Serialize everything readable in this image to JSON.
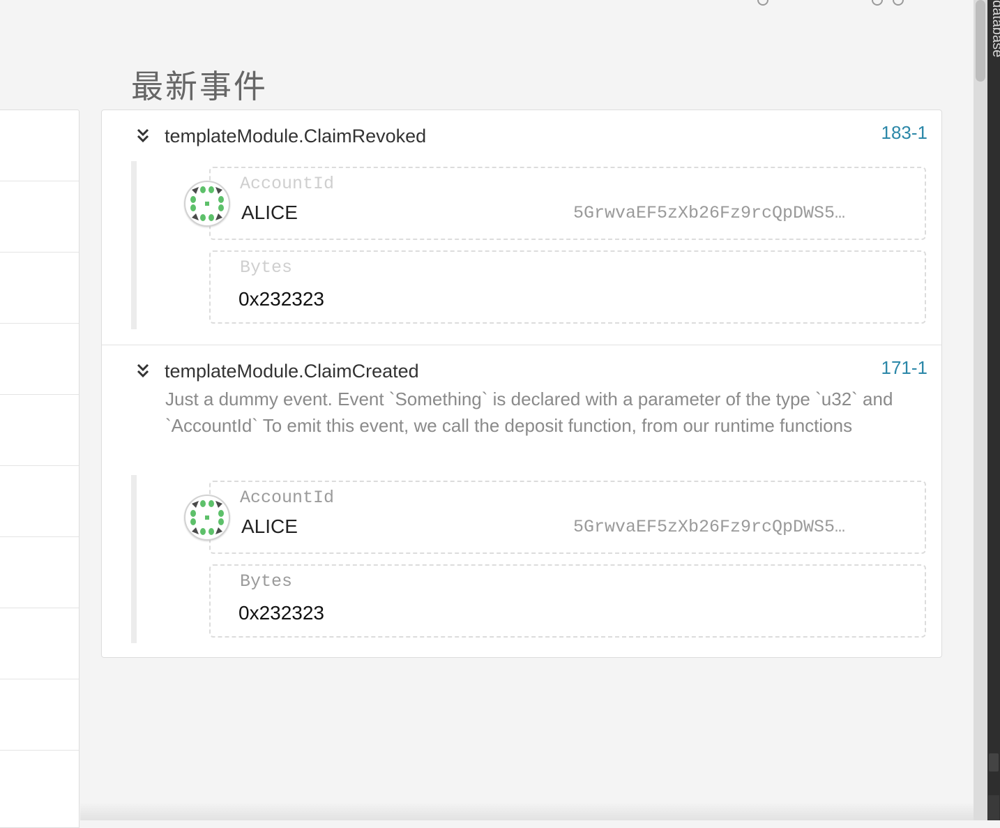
{
  "page": {
    "section_title": "最新事件",
    "side_panel_label": "database"
  },
  "events": [
    {
      "name": "templateModule.ClaimRevoked",
      "index": "183-1",
      "description": "",
      "params": [
        {
          "label": "AccountId",
          "name": "ALICE",
          "address": "5GrwvaEF5zXb26Fz9rcQpDWS5…"
        },
        {
          "label": "Bytes",
          "value": "0x232323"
        }
      ]
    },
    {
      "name": "templateModule.ClaimCreated",
      "index": "171-1",
      "description": "Just a dummy event. Event `Something` is declared with a parameter of the type `u32` and `AccountId` To emit this event, we call the deposit function, from our runtime functions",
      "params": [
        {
          "label": "AccountId",
          "name": "ALICE",
          "address": "5GrwvaEF5zXb26Fz9rcQpDWS5…"
        },
        {
          "label": "Bytes",
          "value": "0x232323"
        }
      ]
    }
  ],
  "icons": {
    "expand": "chevron-double-down-icon",
    "avatar": "identicon-avatar",
    "avatar_colors": [
      "#5dc06a",
      "#4a4a4a",
      "#ffffff"
    ]
  }
}
